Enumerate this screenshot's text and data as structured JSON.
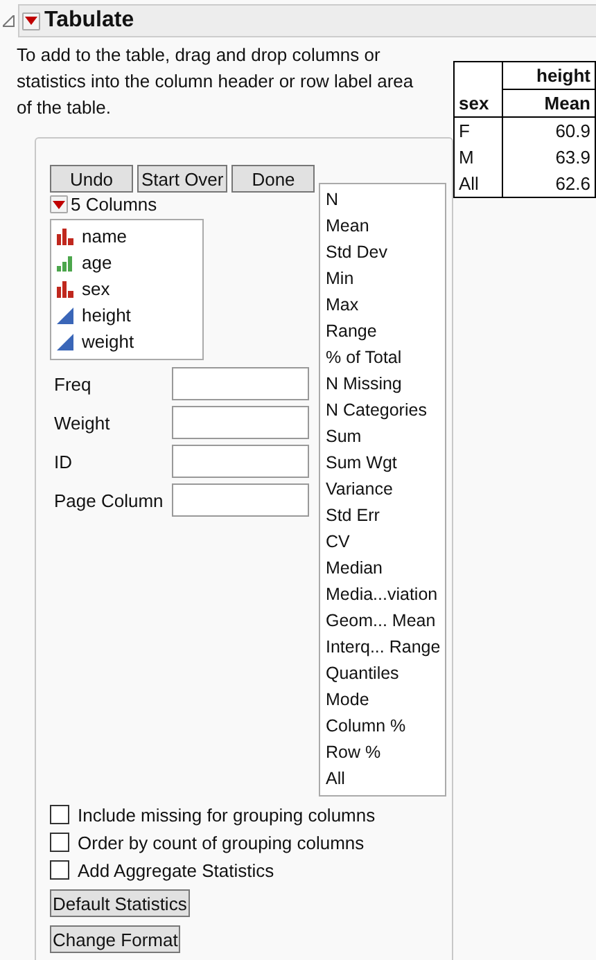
{
  "title": "Tabulate",
  "instructions": "To add to the table, drag and drop columns or statistics into the column header or row label area of the table.",
  "buttons": [
    "Undo",
    "Start Over",
    "Done"
  ],
  "columns_header": "5 Columns",
  "columns": [
    {
      "name": "name",
      "kind": "nominal"
    },
    {
      "name": "age",
      "kind": "ordinal"
    },
    {
      "name": "sex",
      "kind": "nominal"
    },
    {
      "name": "height",
      "kind": "continuous"
    },
    {
      "name": "weight",
      "kind": "continuous"
    }
  ],
  "roles": [
    {
      "label": "Freq"
    },
    {
      "label": "Weight"
    },
    {
      "label": "ID"
    },
    {
      "label": "Page Column"
    }
  ],
  "statistics": [
    "N",
    "Mean",
    "Std Dev",
    "Min",
    "Max",
    "Range",
    "% of Total",
    "N Missing",
    "N Categories",
    "Sum",
    "Sum Wgt",
    "Variance",
    "Std Err",
    "CV",
    "Median",
    "Media...viation",
    "Geom... Mean",
    "Interq... Range",
    "Quantiles",
    "Mode",
    "Column %",
    "Row %",
    "All"
  ],
  "options": [
    {
      "label": "Include missing for grouping columns",
      "checked": false
    },
    {
      "label": "Order by count of grouping columns",
      "checked": false
    },
    {
      "label": "Add Aggregate Statistics",
      "checked": false
    }
  ],
  "bottom_buttons": [
    "Default Statistics",
    "Change Format"
  ],
  "table": {
    "column_header": "height",
    "row_header": "sex",
    "statistic": "Mean",
    "rows": [
      {
        "label": "F",
        "value": "60.9"
      },
      {
        "label": "M",
        "value": "63.9"
      },
      {
        "label": "All",
        "value": "62.6"
      }
    ]
  }
}
